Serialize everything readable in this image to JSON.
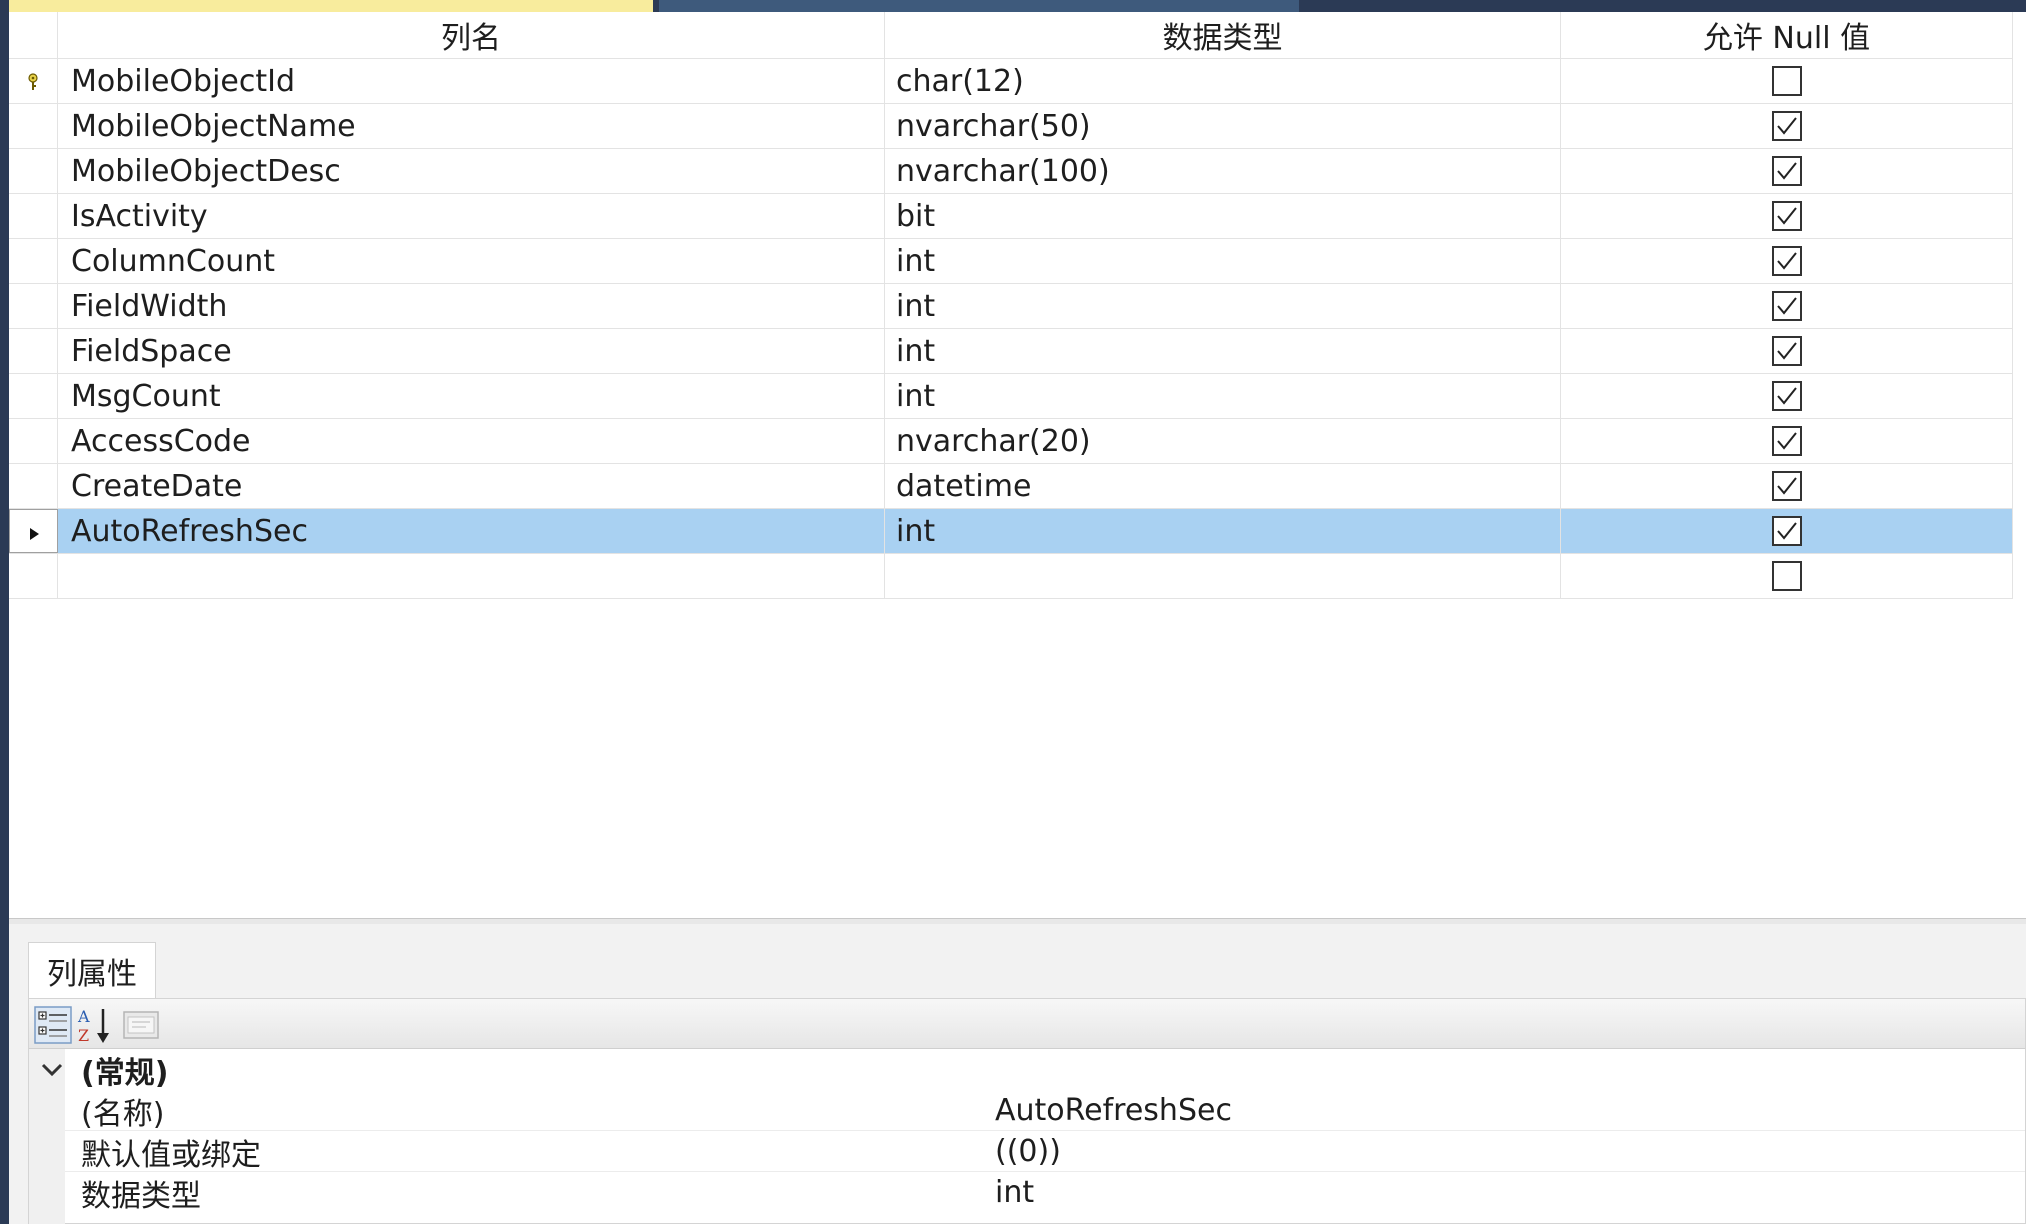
{
  "grid": {
    "headers": {
      "name": "列名",
      "type": "数据类型",
      "null": "允许 Null 值"
    },
    "rows": [
      {
        "name": "MobileObjectId",
        "type": "char(12)",
        "allow_null": false,
        "key": true
      },
      {
        "name": "MobileObjectName",
        "type": "nvarchar(50)",
        "allow_null": true
      },
      {
        "name": "MobileObjectDesc",
        "type": "nvarchar(100)",
        "allow_null": true
      },
      {
        "name": "IsActivity",
        "type": "bit",
        "allow_null": true
      },
      {
        "name": "ColumnCount",
        "type": "int",
        "allow_null": true
      },
      {
        "name": "FieldWidth",
        "type": "int",
        "allow_null": true
      },
      {
        "name": "FieldSpace",
        "type": "int",
        "allow_null": true
      },
      {
        "name": "MsgCount",
        "type": "int",
        "allow_null": true
      },
      {
        "name": "AccessCode",
        "type": "nvarchar(20)",
        "allow_null": true
      },
      {
        "name": "CreateDate",
        "type": "datetime",
        "allow_null": true
      },
      {
        "name": "AutoRefreshSec",
        "type": "int",
        "allow_null": true,
        "selected": true
      },
      {
        "name": "",
        "type": "",
        "allow_null": false
      }
    ]
  },
  "properties": {
    "tab_label": "列属性",
    "category": "(常规)",
    "items": [
      {
        "name": "(名称)",
        "value": "AutoRefreshSec"
      },
      {
        "name": "默认值或绑定",
        "value": "((0))"
      },
      {
        "name": "数据类型",
        "value": "int"
      }
    ]
  },
  "icons": {
    "key": "primary-key-icon",
    "row_selector": "row-selector-arrow-icon",
    "categorized": "categorized-icon",
    "alphabetical": "alphabetical-sort-icon",
    "property_pages": "property-pages-icon"
  },
  "colors": {
    "selection": "#a9d1f2",
    "tab_active": "#f8ec9d",
    "frame": "#2b3a55"
  }
}
